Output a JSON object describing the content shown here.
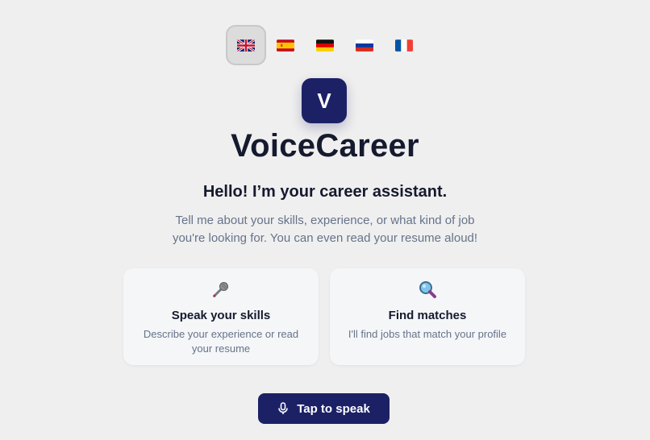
{
  "languages": [
    {
      "code": "en",
      "icon": "uk-flag-icon",
      "active": true
    },
    {
      "code": "es",
      "icon": "spain-flag-icon",
      "active": false
    },
    {
      "code": "de",
      "icon": "germany-flag-icon",
      "active": false
    },
    {
      "code": "ru",
      "icon": "russia-flag-icon",
      "active": false
    },
    {
      "code": "fr",
      "icon": "france-flag-icon",
      "active": false
    }
  ],
  "logo": {
    "letter": "V"
  },
  "app": {
    "title": "VoiceCareer"
  },
  "hero": {
    "greeting": "Hello! I’m your career assistant.",
    "intro": "Tell me about your skills, experience, or what kind of job you're looking for. You can even read your resume aloud!"
  },
  "cards": [
    {
      "icon": "microphone-icon",
      "title": "Speak your skills",
      "description": "Describe your experience or read your resume"
    },
    {
      "icon": "magnifying-glass-icon",
      "title": "Find matches",
      "description": "I'll find jobs that match your profile"
    }
  ],
  "action": {
    "label": "Tap to speak",
    "icon": "mic-icon"
  },
  "colors": {
    "primary": "#1c2166",
    "background": "#efefef",
    "card": "#f5f6f8",
    "muted_text": "#66738a"
  }
}
